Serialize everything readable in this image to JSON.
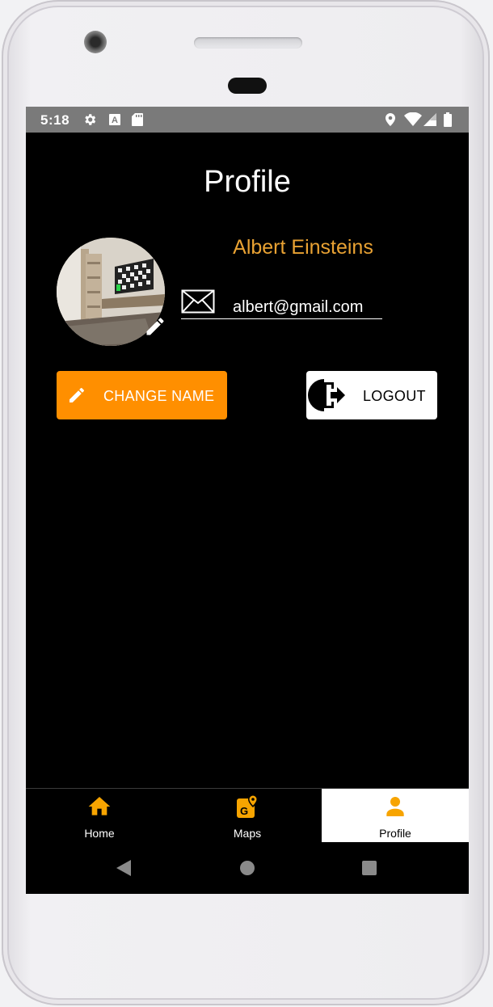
{
  "status_bar": {
    "time": "5:18",
    "left_icons": [
      "gear-icon",
      "a-icon",
      "sd-card-icon"
    ],
    "right_icons": [
      "location-icon",
      "wifi-icon",
      "signal-icon",
      "battery-icon"
    ]
  },
  "page": {
    "title": "Profile"
  },
  "profile": {
    "name": "Albert Einsteins",
    "email": "albert@gmail.com",
    "avatar_icon": "room-photo",
    "edit_icon": "pencil-icon"
  },
  "buttons": {
    "change_name": "CHANGE NAME",
    "logout": "LOGOUT"
  },
  "bottom_nav": {
    "items": [
      {
        "label": "Home",
        "icon": "home-icon"
      },
      {
        "label": "Maps",
        "icon": "map-icon"
      },
      {
        "label": "Profile",
        "icon": "person-icon"
      }
    ],
    "active": "Profile"
  },
  "colors": {
    "accent": "#ff8f00",
    "name_text": "#e9a233",
    "screen_bg": "#000000",
    "status_bar": "#7a7a7a"
  }
}
